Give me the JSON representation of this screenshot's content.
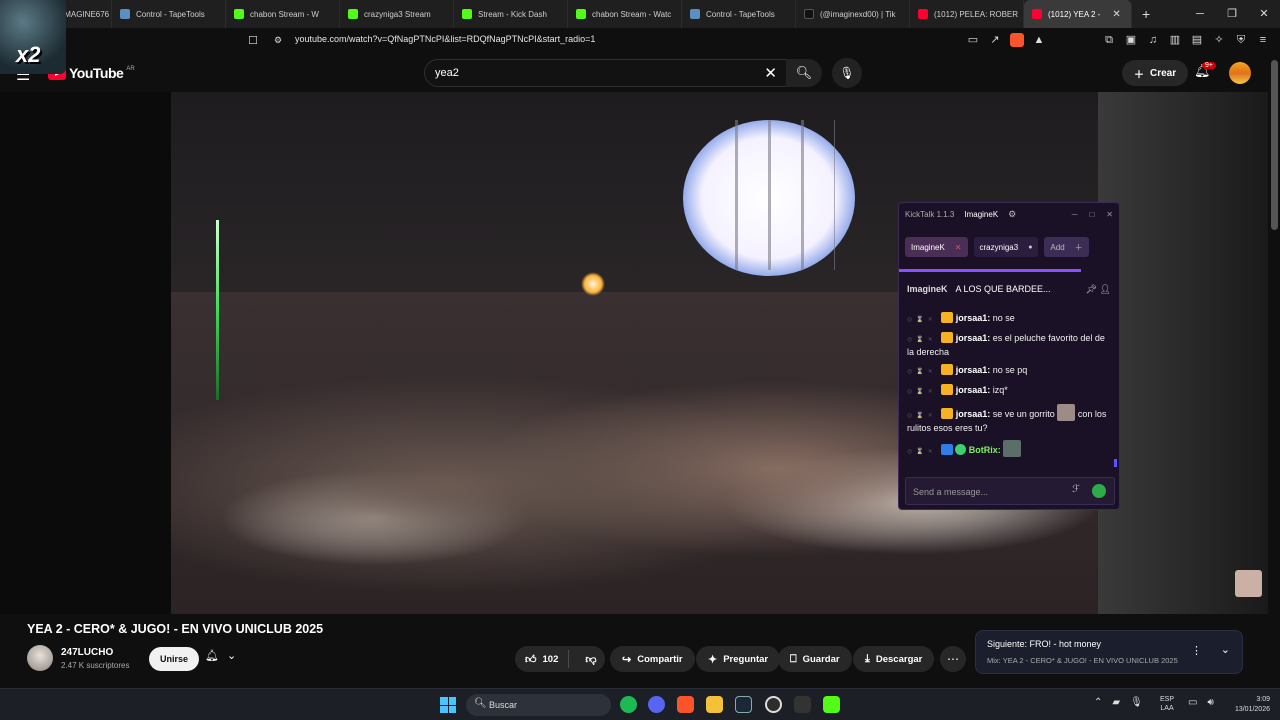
{
  "browser": {
    "tabs": [
      {
        "label": "IMAGINE676",
        "color": "#3a3a3a"
      },
      {
        "label": "Control - TapeTools",
        "color": "#5a8fbf"
      },
      {
        "label": "chabon Stream - W",
        "color": "#53fc18"
      },
      {
        "label": "crazyniga3 Stream",
        "color": "#53fc18"
      },
      {
        "label": "Stream - Kick Dash",
        "color": "#53fc18"
      },
      {
        "label": "chabon Stream - Watc",
        "color": "#53fc18"
      },
      {
        "label": "Control - TapeTools",
        "color": "#5a8fbf"
      },
      {
        "label": "(@imaginexd00) | Tik",
        "color": "#111111"
      },
      {
        "label": "(1012) PELEA: ROBER",
        "color": "#ff0033"
      },
      {
        "label": "(1012) YEA 2 -",
        "color": "#ff0033"
      }
    ],
    "url": "youtube.com/watch?v=QfNagPTNcPI&list=RDQfNagPTNcPI&start_radio=1"
  },
  "overlay": {
    "multiplier": "x2"
  },
  "youtube": {
    "logo_text": "YouTube",
    "region": "AR",
    "search_query": "yea2",
    "create_label": "Crear",
    "notifications_badge": "9+"
  },
  "kicktalk": {
    "app_name": "KickTalk 1.1.3",
    "user": "ImagineK",
    "tabs": [
      {
        "label": "ImagineK"
      },
      {
        "label": "crazyniga3"
      }
    ],
    "add_label": "Add",
    "pinned": {
      "name": "ImagineK",
      "message": "A LOS QUE BARDEE..."
    },
    "messages": [
      {
        "user": "jorsaa1:",
        "text": " no se"
      },
      {
        "user": "jorsaa1:",
        "text": " es el peluche favorito del de la derecha"
      },
      {
        "user": "jorsaa1:",
        "text": " no se pq"
      },
      {
        "user": "jorsaa1:",
        "text": " izq*"
      },
      {
        "user": "jorsaa1:",
        "text": " se ve un gorrito",
        "text2": " con los rulitos esos eres tu?"
      },
      {
        "user": "BotRix:",
        "text": ""
      }
    ],
    "input_placeholder": "Send a message..."
  },
  "video": {
    "title": "YEA 2 - CERO* & JUGO! - EN VIVO UNICLUB 2025",
    "channel": "247LUCHO",
    "subscribers": "2.47 K suscriptores",
    "join_label": "Unirse",
    "likes": "102",
    "share_label": "Compartir",
    "ask_label": "Preguntar",
    "save_label": "Guardar",
    "download_label": "Descargar"
  },
  "next": {
    "title": "Siguiente: FRO! - hot money",
    "subtitle": "Mix: YEA 2 - CERO* & JUGO! - EN VIVO UNICLUB 2025"
  },
  "taskbar": {
    "search_label": "Buscar",
    "lang_top": "ESP",
    "lang_bottom": "LAA",
    "time": "3:09",
    "date": "13/01/2026"
  }
}
